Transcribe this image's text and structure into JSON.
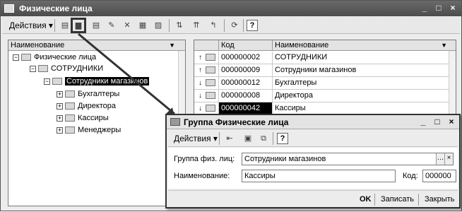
{
  "window": {
    "title": "Физические лица"
  },
  "toolbar": {
    "actions_label": "Действия",
    "help_label": "?"
  },
  "tree": {
    "header": "Наименование",
    "nodes": [
      {
        "label": "Физические лица"
      },
      {
        "label": "СОТРУДНИКИ"
      },
      {
        "label": "Сотрудники магазинов"
      },
      {
        "label": "Бухгалтеры"
      },
      {
        "label": "Директора"
      },
      {
        "label": "Кассиры"
      },
      {
        "label": "Менеджеры"
      }
    ]
  },
  "list": {
    "columns": [
      "Код",
      "Наименование"
    ],
    "rows": [
      {
        "marker": "↑",
        "code": "000000002",
        "name": "СОТРУДНИКИ"
      },
      {
        "marker": "↑",
        "code": "000000009",
        "name": "Сотрудники магазинов"
      },
      {
        "marker": "↓",
        "code": "000000012",
        "name": "Бухгалтеры"
      },
      {
        "marker": "↓",
        "code": "000000008",
        "name": "Директора"
      },
      {
        "marker": "↓",
        "code": "000000042",
        "name": "Кассиры"
      }
    ]
  },
  "dialog": {
    "title": "Группа Физические лица",
    "actions_label": "Действия",
    "help_label": "?",
    "group_label": "Группа физ. лиц:",
    "group_value": "Сотрудники магазинов",
    "name_label": "Наименование:",
    "name_value": "Кассиры",
    "code_label": "Код:",
    "code_value": "000000",
    "ok_label": "OK",
    "save_label": "Записать",
    "close_label": "Закрыть"
  }
}
